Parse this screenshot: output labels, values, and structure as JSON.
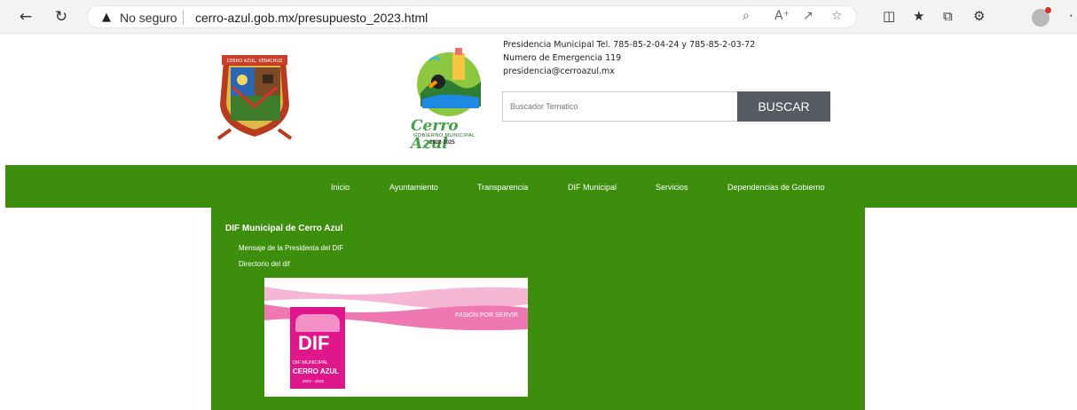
{
  "browser": {
    "security_label": "No seguro",
    "url": "cerro-azul.gob.mx/presupuesto_2023.html"
  },
  "header": {
    "shield_label": "CERRO AZUL, VERACRUZ",
    "logo_title": "Cerro Azul",
    "logo_subtitle": "GOBIERNO MUNICIPAL",
    "logo_years": "2022-2025",
    "contact_phone": "Presidencia Municipal Tel. 785-85-2-04-24 y 785-85-2-03-72",
    "contact_emergency": "Numero de Emergencia 119",
    "contact_email": "presidencia@cerroazul.mx",
    "search_placeholder": "Buscador Tematico",
    "search_button": "BUSCAR"
  },
  "nav": {
    "items": [
      "Inicio",
      "Ayuntamiento",
      "Transparencia",
      "DIF Municipal",
      "Servicios",
      "Dependencias de Gobierno"
    ]
  },
  "content": {
    "title": "DIF Municipal de Cerro Azul",
    "links": [
      "Mensaje de la Presidenta del DIF",
      "Directorio del dif"
    ],
    "banner_tagline": "PASIÓN POR SERVIR",
    "banner_logo_text": "DIF",
    "banner_sub1": "DIF MUNICIPAL",
    "banner_sub2": "CERRO AZUL",
    "banner_years": "2022 - 2025"
  },
  "colors": {
    "nav_green": "#3e8e0e",
    "search_button": "#555b61",
    "dif_pink": "#e0168b"
  }
}
